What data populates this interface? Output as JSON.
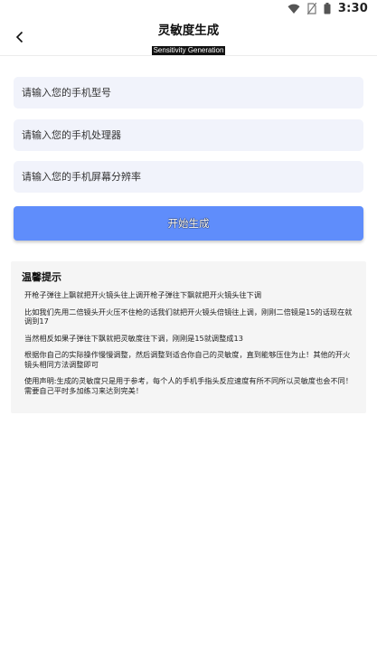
{
  "status_bar": {
    "time": "3:30"
  },
  "header": {
    "title": "灵敏度生成",
    "subtitle": "Sensitivity Generation"
  },
  "form": {
    "model_placeholder": "请输入您的手机型号",
    "processor_placeholder": "请输入您的手机处理器",
    "resolution_placeholder": "请输入您的手机屏幕分辨率",
    "start_label": "开始生成"
  },
  "tips": {
    "title": "温馨提示",
    "items": [
      "开枪子弹往上飘就把开火镜头往上调开枪子弹往下飘就把开火镜头往下调",
      "比如我们先用二倍镜头开火压不住枪的话我们就把开火镜头倍镜往上调，刚刚二倍镜是15的话现在就调到17",
      "当然相反如果子弹往下飘就把灵敏度往下调，刚刚是15就调整成13",
      "根据你自己的实际操作慢慢调整，然后调整到适合你自己的灵敏度，直到能够压住为止！其他的开火镜头相同方法调整即可",
      "使用声明:生成的灵敏度只是用于参考，每个人的手机手指头反应速度有所不同所以灵敏度也会不同！需要自己平时多加练习来达到完美！"
    ]
  },
  "colors": {
    "accent": "#5f8dfb",
    "input_bg": "#f1f3fb",
    "tips_bg": "#f5f5f5"
  }
}
